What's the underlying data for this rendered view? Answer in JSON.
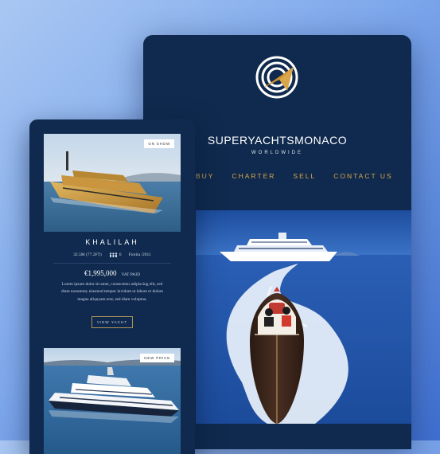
{
  "desktop": {
    "brand": "SUPERYACHTSMONACO",
    "brand_sub": "WORLDWIDE",
    "nav": [
      "BUY",
      "CHARTER",
      "SELL",
      "CONTACT US"
    ]
  },
  "mobile": {
    "listing1": {
      "badge": "ON SHOW",
      "name": "KHALILAH",
      "length": "32.5M (77.2FT)",
      "guests": "6",
      "builder": "Fiorita /2011",
      "price": "€1,995,000",
      "vat": "VAT PAID",
      "description": "Lorem ipsum dolor sit amet, consectetur adipiscing elit, sed diam nonummy eiusmod tempor invidunt ut labore et dolore magna aliquyam erat, sed diam voluptua.",
      "button": "VIEW YACHT"
    },
    "listing2": {
      "badge": "NEW PRICE"
    }
  },
  "colors": {
    "navy": "#0f2a4e",
    "gold": "#d9a64a",
    "sea": "#2c5aa8"
  }
}
